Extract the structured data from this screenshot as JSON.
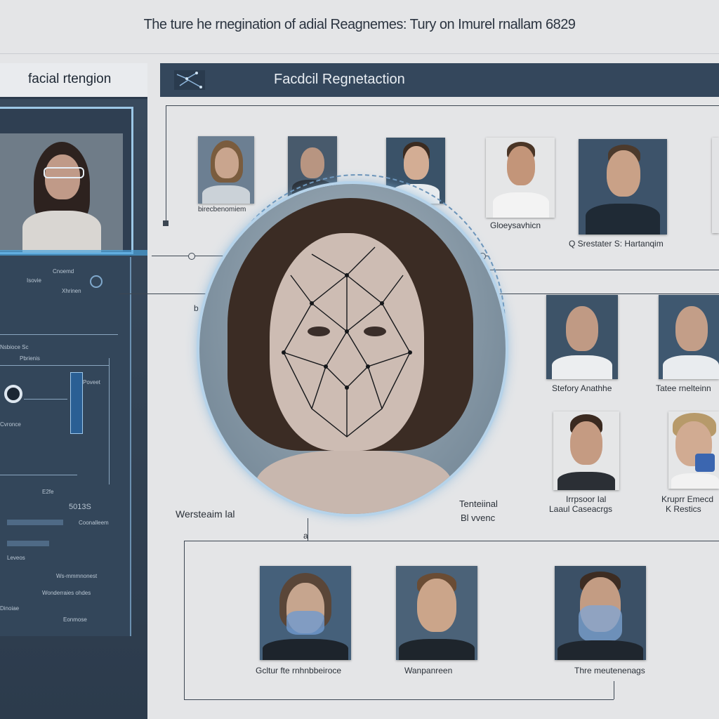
{
  "page_title": "The ture he rnegination of adial Reagnemes: Tury on Imurel rnallam 6829",
  "left_panel": {
    "title": "facial rtengion",
    "labels": [
      "Cnoemd",
      "Isovie",
      "Xhrinen",
      "Nsbioce Sc",
      "Pbrienis",
      "Poveet",
      "Cvronce",
      "E2fe",
      "5013S",
      "Coonalleem",
      "Leveos",
      "Ws-mmmnonest",
      "Wonderraies ohdes",
      "Dinoiae",
      "Eonmose"
    ]
  },
  "main_header": {
    "title": "Facdcil Regnetaction"
  },
  "captions": {
    "row1_a": "birecbenomiem",
    "row1_b": "Gloeysavhicn",
    "row1_c": "Q Srestater S: Hartanqim",
    "mid_left": "Wersteaim lal",
    "mid_center_a": "Tenteiinal",
    "mid_center_b": "Bl vvenc",
    "right_a": "Stefory Anathhe",
    "right_b": "Tatee rnelteinn",
    "right_c_a": "Irrpsoor Ial",
    "right_c_b": "Laaul Caseacrgs",
    "right_d_a": "Kruprr Emecd",
    "right_d_b": "K  Restics",
    "bottom_a": "Gcltur fte rnhnbbeiroce",
    "bottom_b": "Wanpanreen",
    "bottom_c": "Thre meutenenags",
    "node_a": "b",
    "node_b": "a"
  },
  "colors": {
    "panel_dark": "#34475c",
    "accent_blue": "#4aa3dc",
    "background": "#e4e5e7"
  }
}
